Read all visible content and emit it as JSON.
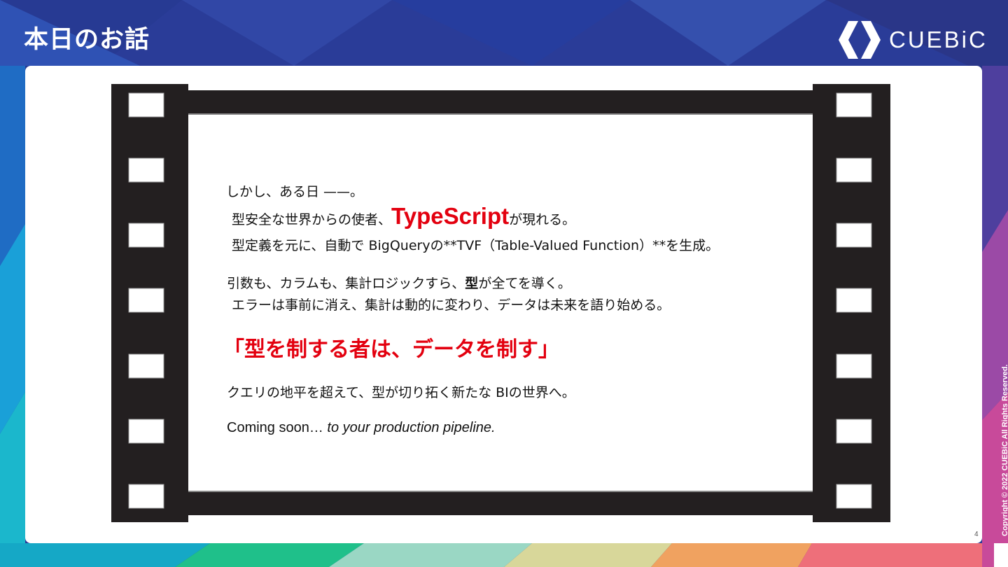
{
  "header": {
    "title": "本日のお話"
  },
  "brand": {
    "name": "CUEBiC"
  },
  "copyright": "Copyright © 2022 CUEBiC All Rights Reserved.",
  "page_number": "4",
  "colors": {
    "accent_red": "#e3000f",
    "film_black": "#231f20",
    "background_blue": "#2b3f9c"
  },
  "content": {
    "line1": "しかし、ある日 ——。",
    "line2_pre": "型安全な世界からの使者、",
    "line2_highlight": "TypeScript",
    "line2_post": "が現れる。",
    "line3": "型定義を元に、自動で BigQueryの**TVF（Table-Valued Function）**を生成。",
    "line4_pre": "引数も、カラムも、集計ロジックすら、",
    "line4_bold": "型",
    "line4_post": "が全てを導く。",
    "line5": "エラーは事前に消え、集計は動的に変わり、データは未来を語り始める。",
    "motto": "「型を制する者は、データを制す」",
    "line6": "クエリの地平を超えて、型が切り拓く新たな BIの世界へ。",
    "line7_plain": "Coming soon… ",
    "line7_italic": "to your production pipeline."
  }
}
